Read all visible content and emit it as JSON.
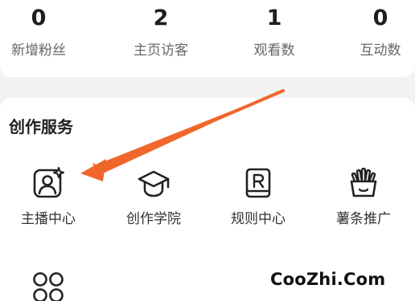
{
  "stats": [
    {
      "value": "0",
      "label": "新增粉丝"
    },
    {
      "value": "2",
      "label": "主页访客"
    },
    {
      "value": "1",
      "label": "观看数"
    },
    {
      "value": "0",
      "label": "互动数"
    }
  ],
  "services": {
    "title": "创作服务",
    "items": [
      {
        "label": "主播中心",
        "icon": "anchor-center-icon"
      },
      {
        "label": "创作学院",
        "icon": "graduation-cap-icon"
      },
      {
        "label": "规则中心",
        "icon": "rule-book-icon"
      },
      {
        "label": "薯条推广",
        "icon": "fries-icon"
      }
    ],
    "more_icon": "grid-apps-icon"
  },
  "annotation": {
    "arrow_color": "#f0662b"
  },
  "watermark": "CooZhi.Com"
}
